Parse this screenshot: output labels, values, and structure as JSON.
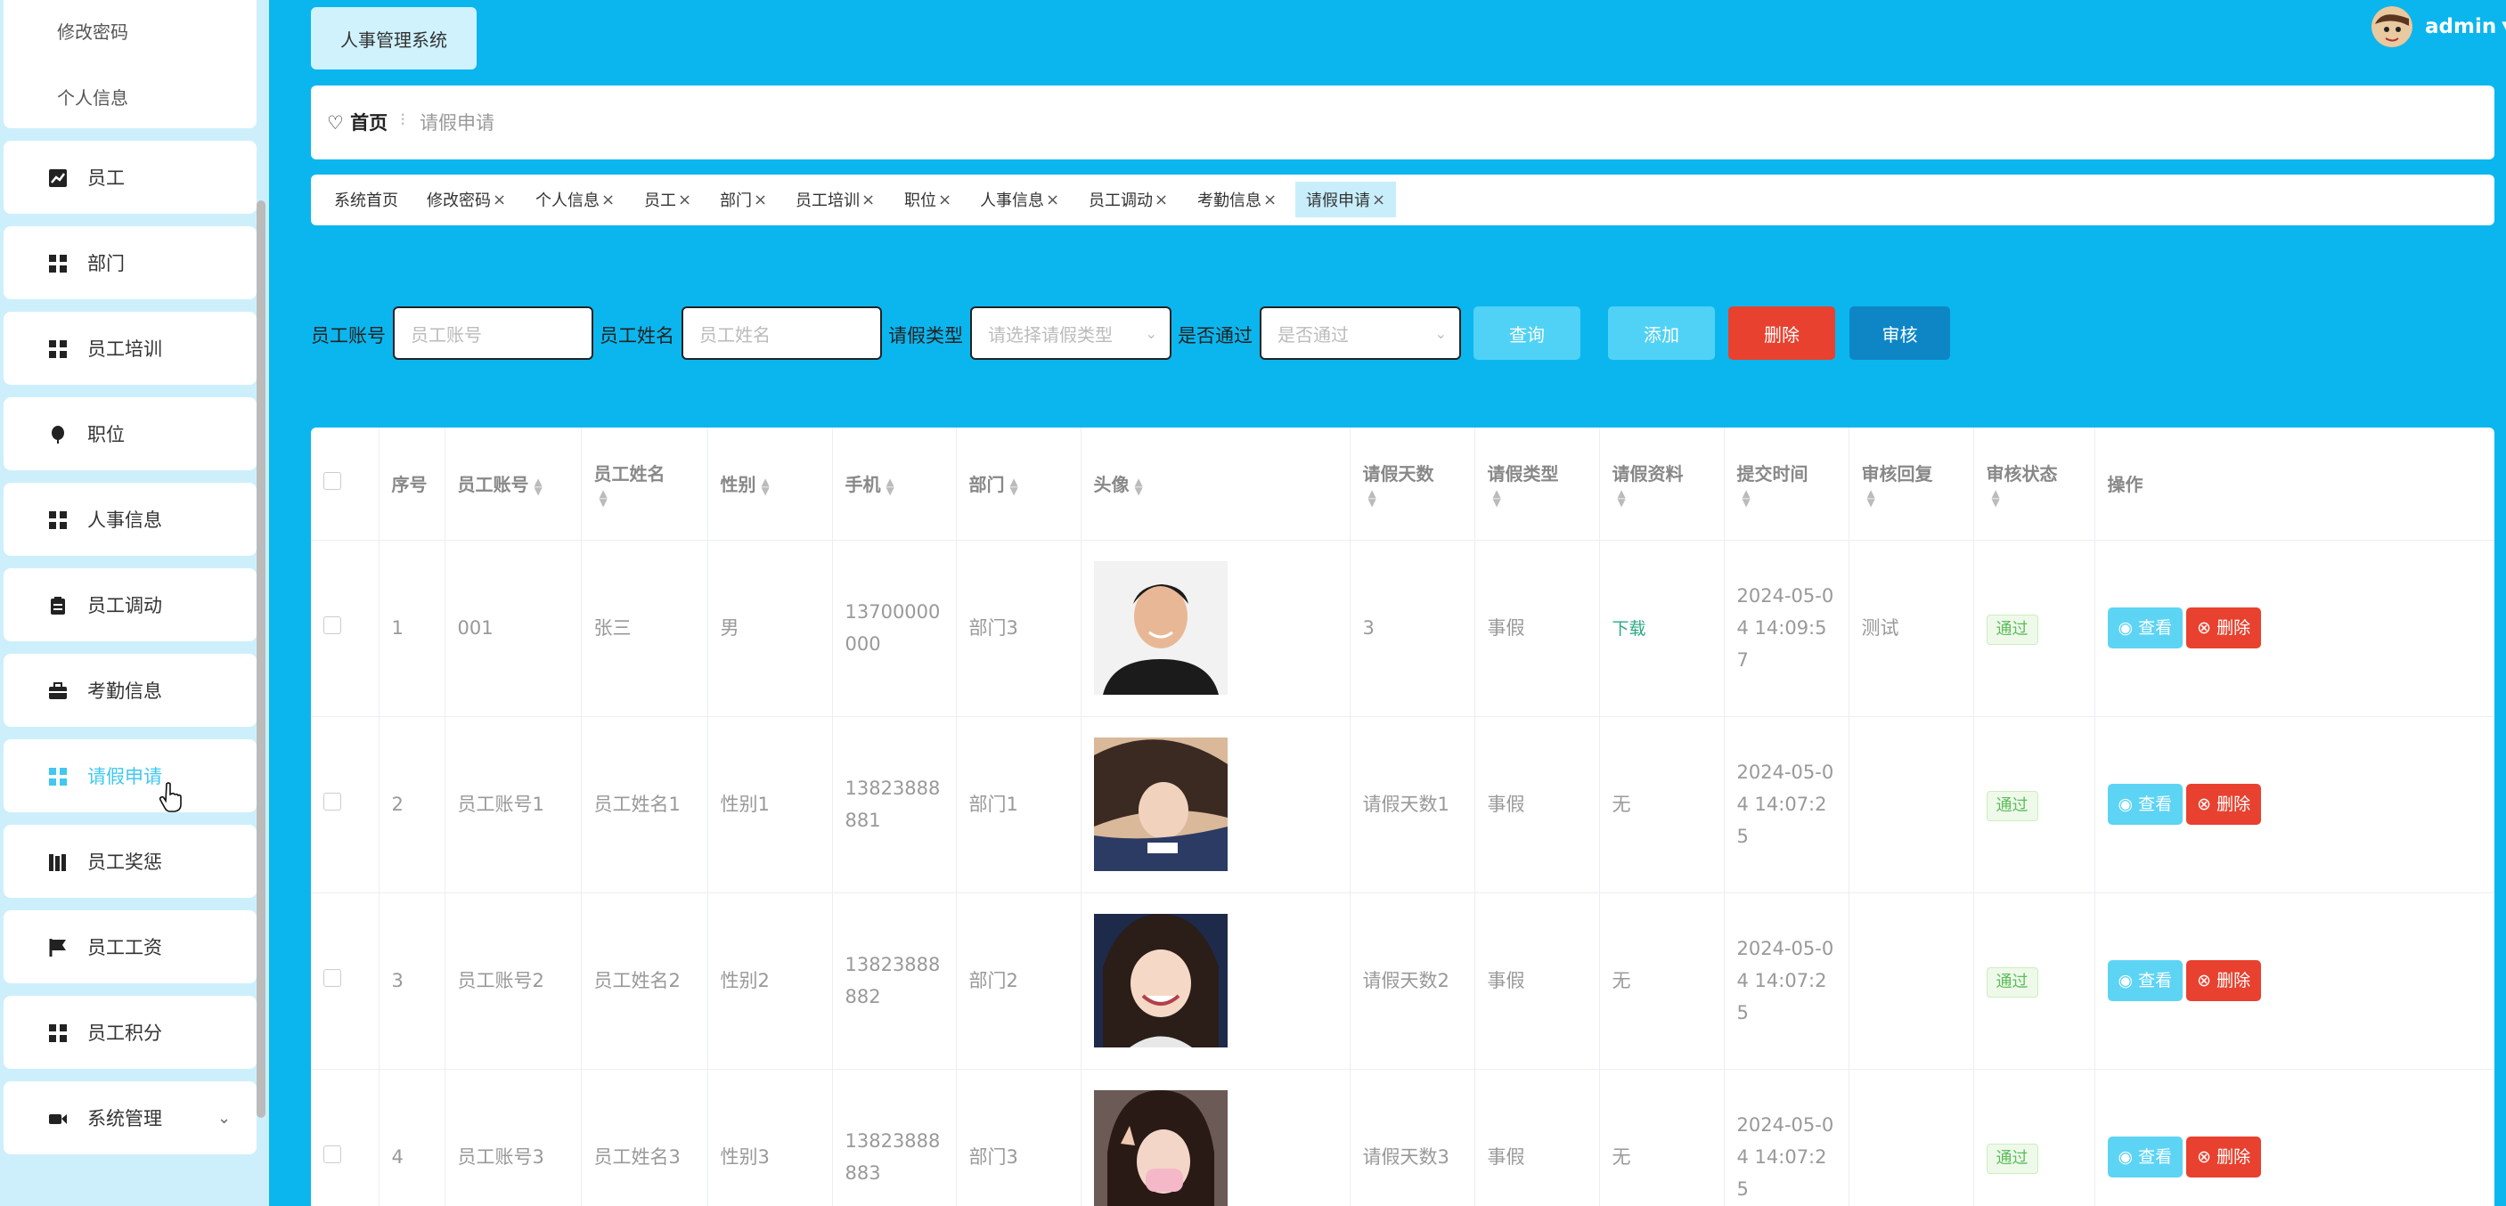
{
  "sidebar": {
    "sub_items": [
      "修改密码",
      "个人信息"
    ],
    "items": [
      {
        "label": "员工",
        "icon": "chart-icon"
      },
      {
        "label": "部门",
        "icon": "grid-icon"
      },
      {
        "label": "员工培训",
        "icon": "grid-icon"
      },
      {
        "label": "职位",
        "icon": "balloon-icon"
      },
      {
        "label": "人事信息",
        "icon": "grid-icon"
      },
      {
        "label": "员工调动",
        "icon": "clipboard-icon"
      },
      {
        "label": "考勤信息",
        "icon": "briefcase-icon"
      },
      {
        "label": "请假申请",
        "icon": "grid-icon",
        "active": true
      },
      {
        "label": "员工奖惩",
        "icon": "books-icon"
      },
      {
        "label": "员工工资",
        "icon": "flag-icon"
      },
      {
        "label": "员工积分",
        "icon": "grid-icon"
      },
      {
        "label": "系统管理",
        "icon": "video-icon",
        "expandable": true
      }
    ]
  },
  "header": {
    "system_title": "人事管理系统",
    "user": "admin"
  },
  "breadcrumb": {
    "home": "首页",
    "current": "请假申请"
  },
  "tabs": [
    {
      "label": "系统首页",
      "closable": false
    },
    {
      "label": "修改密码",
      "closable": true
    },
    {
      "label": "个人信息",
      "closable": true
    },
    {
      "label": "员工",
      "closable": true
    },
    {
      "label": "部门",
      "closable": true
    },
    {
      "label": "员工培训",
      "closable": true
    },
    {
      "label": "职位",
      "closable": true
    },
    {
      "label": "人事信息",
      "closable": true
    },
    {
      "label": "员工调动",
      "closable": true
    },
    {
      "label": "考勤信息",
      "closable": true
    },
    {
      "label": "请假申请",
      "closable": true,
      "active": true
    }
  ],
  "search": {
    "account_label": "员工账号",
    "account_placeholder": "员工账号",
    "name_label": "员工姓名",
    "name_placeholder": "员工姓名",
    "type_label": "请假类型",
    "type_placeholder": "请选择请假类型",
    "pass_label": "是否通过",
    "pass_placeholder": "是否通过",
    "query_btn": "查询",
    "add_btn": "添加",
    "delete_btn": "删除",
    "audit_btn": "审核"
  },
  "table": {
    "columns": [
      "序号",
      "员工账号",
      "员工姓名",
      "性别",
      "手机",
      "部门",
      "头像",
      "请假天数",
      "请假类型",
      "请假资料",
      "提交时间",
      "审核回复",
      "审核状态",
      "操作"
    ],
    "rows": [
      {
        "idx": "1",
        "account": "001",
        "name": "张三",
        "gender": "男",
        "phone": "13700000000",
        "dept": "部门3",
        "days": "3",
        "type": "事假",
        "material": "下载",
        "time": "2024-05-04 14:09:57",
        "reply": "测试",
        "status": "通过"
      },
      {
        "idx": "2",
        "account": "员工账号1",
        "name": "员工姓名1",
        "gender": "性别1",
        "phone": "13823888881",
        "dept": "部门1",
        "days": "请假天数1",
        "type": "事假",
        "material": "无",
        "time": "2024-05-04 14:07:25",
        "reply": "",
        "status": "通过"
      },
      {
        "idx": "3",
        "account": "员工账号2",
        "name": "员工姓名2",
        "gender": "性别2",
        "phone": "13823888882",
        "dept": "部门2",
        "days": "请假天数2",
        "type": "事假",
        "material": "无",
        "time": "2024-05-04 14:07:25",
        "reply": "",
        "status": "通过"
      },
      {
        "idx": "4",
        "account": "员工账号3",
        "name": "员工姓名3",
        "gender": "性别3",
        "phone": "13823888883",
        "dept": "部门3",
        "days": "请假天数3",
        "type": "事假",
        "material": "无",
        "time": "2024-05-04 14:07:25",
        "reply": "",
        "status": "通过"
      }
    ],
    "view_btn": "查看",
    "delete_btn": "删除"
  },
  "colors": {
    "background": "#0bb6ee",
    "sidebar": "#cdeffb",
    "accent": "#40c8f0",
    "danger": "#e8412f",
    "audit": "#0e86c6"
  }
}
